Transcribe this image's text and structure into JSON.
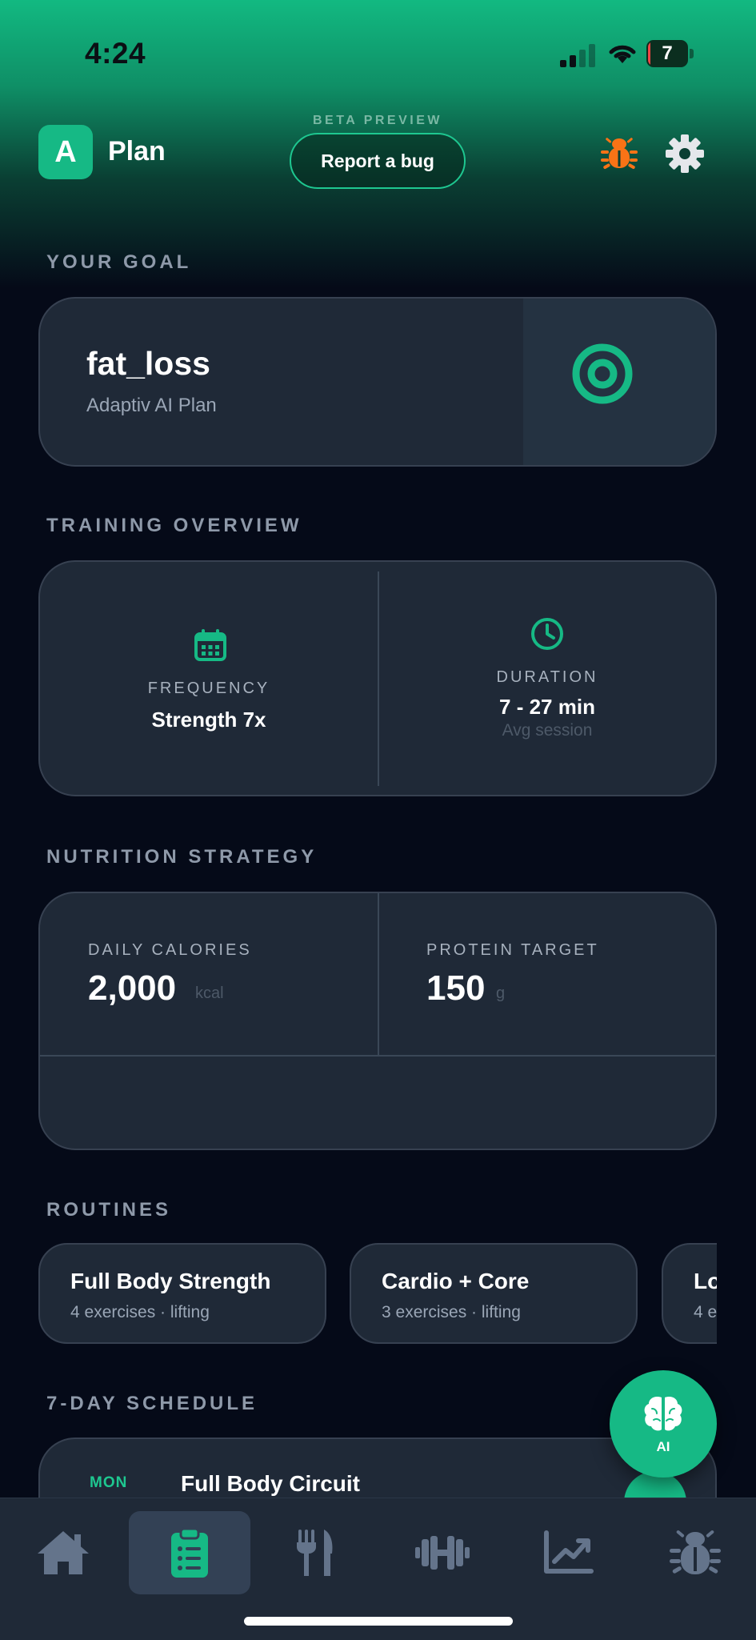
{
  "status_bar": {
    "time": "4:24",
    "battery_percent": "7",
    "battery_level": 0.07
  },
  "header": {
    "logo_letter": "A",
    "title": "Plan",
    "beta_label": "BETA PREVIEW",
    "report_bug_label": "Report a bug"
  },
  "goal": {
    "section_title": "YOUR GOAL",
    "name": "fat_loss",
    "subtitle": "Adaptiv AI Plan"
  },
  "training": {
    "section_title": "TRAINING OVERVIEW",
    "frequency": {
      "label": "FREQUENCY",
      "value": "Strength 7x"
    },
    "duration": {
      "label": "DURATION",
      "value": "7 - 27 min",
      "sub": "Avg session"
    }
  },
  "nutrition": {
    "section_title": "NUTRITION STRATEGY",
    "calories": {
      "label": "DAILY CALORIES",
      "value": "2,000",
      "unit": "kcal"
    },
    "protein": {
      "label": "PROTEIN TARGET",
      "value": "150",
      "unit": "g"
    }
  },
  "routines": {
    "section_title": "ROUTINES",
    "items": [
      {
        "title": "Full Body Strength",
        "subtitle": "4 exercises · lifting"
      },
      {
        "title": "Cardio + Core",
        "subtitle": "3 exercises · lifting"
      },
      {
        "title": "Lo",
        "subtitle": "4 e"
      }
    ]
  },
  "schedule": {
    "section_title": "7-DAY SCHEDULE",
    "days": [
      {
        "day": "MON",
        "title": "Full Body Circuit"
      }
    ]
  },
  "ai_fab": {
    "label": "AI"
  },
  "tabs": [
    {
      "name": "home-icon",
      "active": false
    },
    {
      "name": "plan-clipboard-icon",
      "active": true
    },
    {
      "name": "nutrition-utensils-icon",
      "active": false
    },
    {
      "name": "workout-dumbbell-icon",
      "active": false
    },
    {
      "name": "progress-chart-icon",
      "active": false
    },
    {
      "name": "bug-icon",
      "active": false
    }
  ],
  "colors": {
    "accent": "#16b985",
    "background": "#050a18",
    "card": "#1f2937",
    "bug_orange": "#f97316",
    "text_muted": "#8e99a9"
  }
}
